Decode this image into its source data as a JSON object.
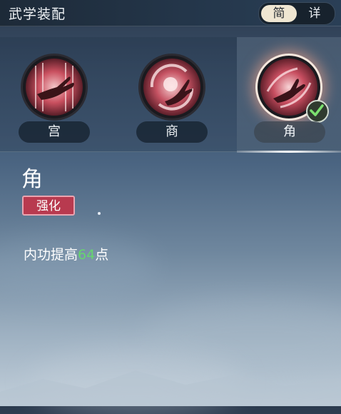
{
  "header": {
    "title": "武学装配",
    "toggle": {
      "simple": "简",
      "detail": "详",
      "active": "简"
    }
  },
  "tabs": [
    {
      "label": "宫",
      "icon": "palm-open-icon",
      "selected": false
    },
    {
      "label": "商",
      "icon": "hand-swirl-icon",
      "selected": false
    },
    {
      "label": "角",
      "icon": "hand-gesture-icon",
      "selected": true,
      "equipped": true
    }
  ],
  "detail": {
    "name": "角",
    "badge": "强化",
    "effect_prefix": "内功提高",
    "effect_value": "64",
    "effect_suffix": "点"
  },
  "colors": {
    "badge": "#b83a4f",
    "highlight_value": "#66d66e",
    "icon_base": "#c04a5c"
  }
}
